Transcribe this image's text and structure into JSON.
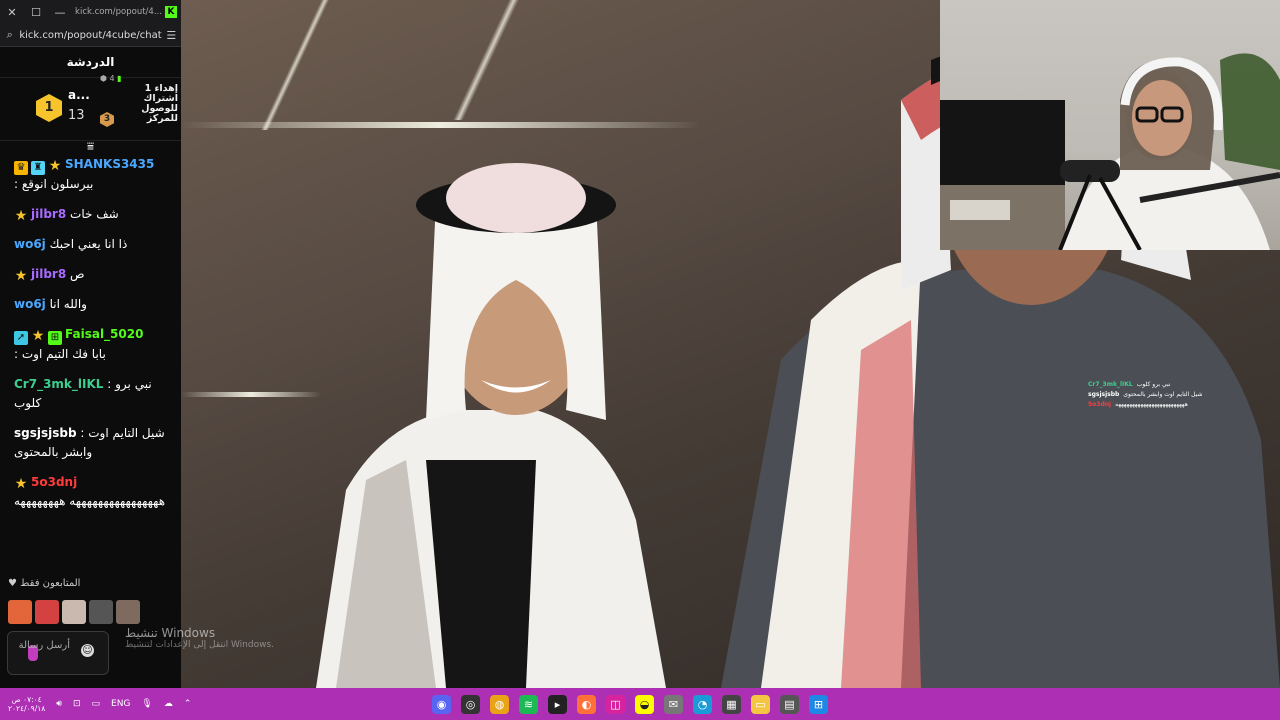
{
  "browser": {
    "tab_url": "kick.com/popout/4...",
    "address": "kick.com/popout/4cube/chat"
  },
  "chat": {
    "title": "الدردشة",
    "top_gifter": {
      "rank": "1",
      "name": "a...",
      "count": "13",
      "small_rank": "3",
      "top_note": "4",
      "description": "إهداء 1 اشتراك للوصول للمركز"
    },
    "messages": [
      {
        "user": "SHANKS3435",
        "color": "#4aa8ff",
        "badges": [
          "crown",
          "green",
          "star"
        ],
        "text": "بيرسلون انوقع :",
        "newline": true
      },
      {
        "user": "jilbr8",
        "color": "#a86bff",
        "badges": [
          "star"
        ],
        "text": "شف خات",
        "newline": false
      },
      {
        "user": "wo6j",
        "color": "#4aa8ff",
        "badges": [],
        "text": "ذا انا يعني احبك",
        "newline": false
      },
      {
        "user": "jilbr8",
        "color": "#a86bff",
        "badges": [
          "star"
        ],
        "text": "ص",
        "newline": false
      },
      {
        "user": "wo6j",
        "color": "#4aa8ff",
        "badges": [],
        "text": "والله انا",
        "newline": false
      },
      {
        "user": "Faisal_5020",
        "color": "#53fc18",
        "badges": [
          "arrow",
          "star",
          "gift"
        ],
        "text": "بابا فك التيم اوت :",
        "newline": true
      },
      {
        "user": "Cr7_3mk_lIKL",
        "color": "#3ecf8e",
        "badges": [],
        "text": "نبي برو : كلوب",
        "newline": false
      },
      {
        "user": "sgsjsjsbb",
        "color": "#ffffff",
        "badges": [],
        "text": "شيل التايم اوت : وابشر بالمحتوى",
        "newline": false
      },
      {
        "user": "5o3dnj",
        "color": "#ff3b3b",
        "badges": [
          "star"
        ],
        "text": "ههههههههههههههههه ههههههههه",
        "newline": true
      }
    ],
    "followers_only": "المتابعون فقط",
    "send_placeholder": "أرسل رسالة"
  },
  "overlay_chat": [
    {
      "user": "Cr7_3mk_lIKL",
      "text": "نبي برو كلوب"
    },
    {
      "user": "sgsjsjsbb",
      "text": "شيل التايم اوت وابشر بالمحتوى"
    },
    {
      "user": "5o3dnj",
      "text": "هههههههههههههههههههههههههه"
    }
  ],
  "watermark": {
    "title": "تنشيط Windows",
    "subtitle": "انتقل إلى الإعدادات لتنشيط Windows."
  },
  "taskbar": {
    "time": "٠٧:٠٤ ص",
    "date": "٢٠٢٤/٠٩/١٨",
    "lang": "ENG",
    "apps": [
      "discord",
      "obs",
      "chrome",
      "spotify",
      "terminal",
      "firefox",
      "instagram",
      "snapchat",
      "mail",
      "edge",
      "calculator",
      "explorer",
      "store",
      "start"
    ]
  }
}
